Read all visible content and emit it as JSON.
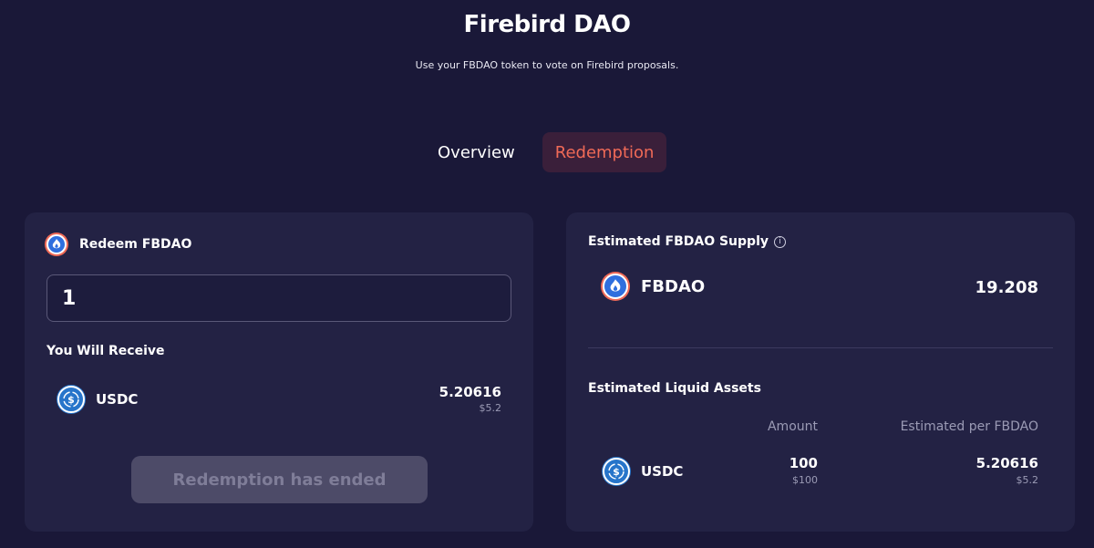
{
  "header": {
    "title": "Firebird DAO",
    "subtitle": "Use your FBDAO token to vote on Firebird proposals."
  },
  "tabs": [
    {
      "label": "Overview",
      "active": false
    },
    {
      "label": "Redemption",
      "active": true
    }
  ],
  "redeem": {
    "title": "Redeem FBDAO",
    "input_value": "1",
    "receive_heading": "You Will Receive",
    "receive_token": "USDC",
    "receive_amount": "5.20616",
    "receive_usd": "$5.2",
    "button_label": "Redemption has ended"
  },
  "supply": {
    "title": "Estimated FBDAO Supply",
    "token": "FBDAO",
    "value": "19.208"
  },
  "liquid_assets": {
    "title": "Estimated Liquid Assets",
    "columns": [
      "Amount",
      "Estimated per FBDAO"
    ],
    "rows": [
      {
        "token": "USDC",
        "amount": "100",
        "amount_usd": "$100",
        "per_fbdao": "5.20616",
        "per_fbdao_usd": "$5.2"
      }
    ]
  },
  "colors": {
    "background": "#1a1838",
    "card": "#232244",
    "accent": "#f06a57",
    "usdc": "#2775ca",
    "fbdao": "#2f6fde"
  },
  "icons": [
    "fbdao-token-icon",
    "usdc-token-icon",
    "info-icon"
  ]
}
